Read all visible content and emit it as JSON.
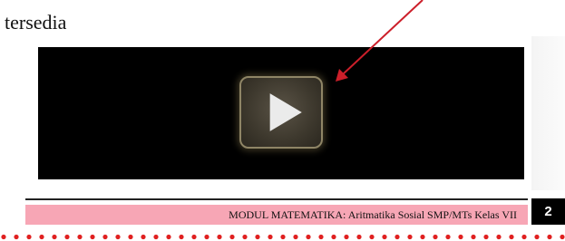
{
  "caption": "tersedia",
  "video": {
    "play_icon": "play-icon"
  },
  "footer": {
    "module_title": "MODUL MATEMATIKA: Aritmatika Sosial SMP/MTs Kelas VII",
    "page_number": "2"
  },
  "colors": {
    "arrow": "#cc1f2a",
    "footer_band": "#f7a6b5",
    "dots": "#e02020",
    "video_bg": "#000000"
  }
}
